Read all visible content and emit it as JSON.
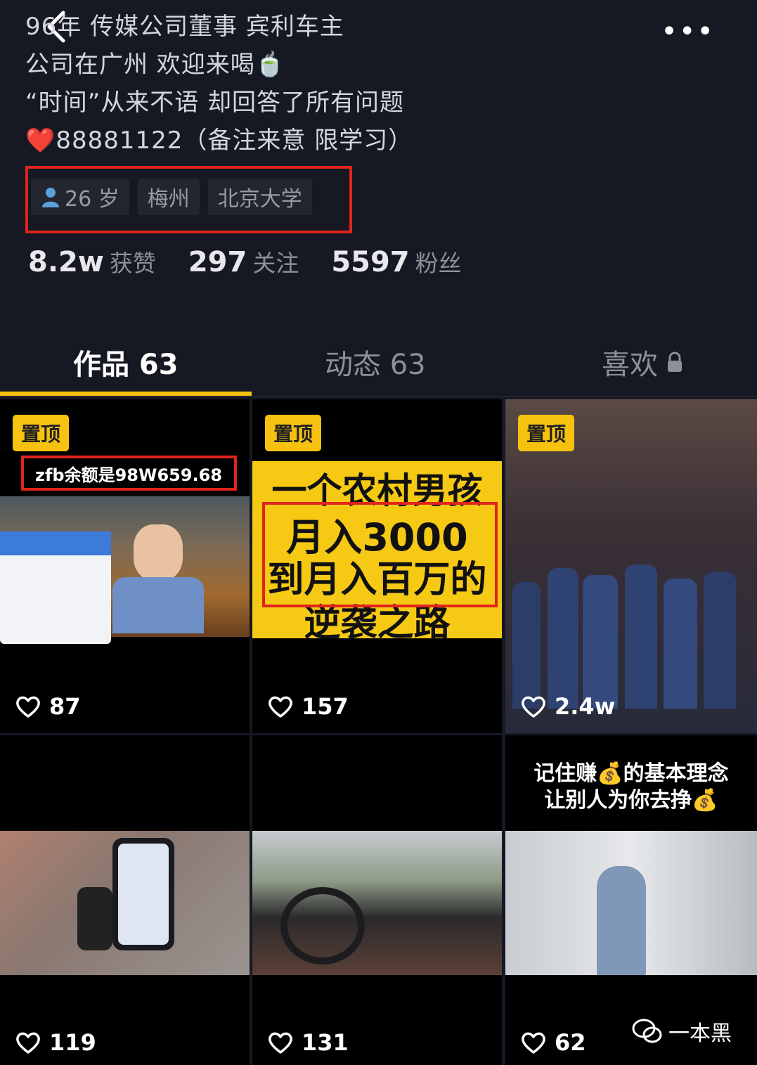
{
  "profile": {
    "bio_lines": [
      "96年 传媒公司董事 宾利车主",
      "公司在广州 欢迎来喝🍵",
      "“时间”从来不语 却回答了所有问题",
      "❤️88881122（备注来意 限学习）"
    ],
    "tags": {
      "age": "26 岁",
      "city": "梅州",
      "school": "北京大学"
    },
    "stats": [
      {
        "value": "8.2w",
        "label": "获赞"
      },
      {
        "value": "297",
        "label": "关注"
      },
      {
        "value": "5597",
        "label": "粉丝"
      }
    ]
  },
  "tabs": [
    {
      "label": "作品 63"
    },
    {
      "label": "动态 63"
    },
    {
      "label": "喜欢"
    }
  ],
  "grid": {
    "pinned_label": "置顶",
    "items": [
      {
        "likes": "87",
        "caption": "zfb余额是98W659.68",
        "pinned": true
      },
      {
        "likes": "157",
        "caption_lines": [
          "一个农村男孩",
          "月入3000",
          "到月入百万的",
          "逆袭之路"
        ],
        "pinned": true
      },
      {
        "likes": "2.4w",
        "pinned": true
      },
      {
        "likes": "119"
      },
      {
        "likes": "131"
      },
      {
        "likes": "62",
        "caption_lines": [
          "记住赚💰的基本理念",
          "让别人为你去挣💰"
        ]
      }
    ]
  },
  "watermark": "一本黑",
  "colors": {
    "background": "#161823",
    "accent": "#f6c20f",
    "highlight_box": "#e0241b"
  },
  "icons": [
    "back-icon",
    "more-icon",
    "person-icon",
    "lock-icon",
    "heart-icon",
    "wechat-icon"
  ]
}
